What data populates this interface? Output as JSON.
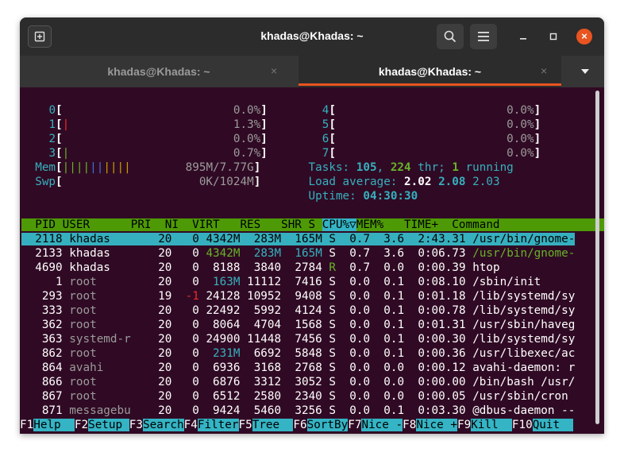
{
  "window": {
    "title": "khadas@Khadas: ~",
    "tabs": [
      {
        "label": "khadas@Khadas: ~",
        "active": false
      },
      {
        "label": "khadas@Khadas: ~",
        "active": true
      }
    ],
    "controls": {
      "close": "×",
      "tab_close": "×"
    }
  },
  "meters": {
    "cpus": [
      {
        "id": "0",
        "bar": "",
        "value": "0.0%"
      },
      {
        "id": "1",
        "bar": "|",
        "value": "1.3%"
      },
      {
        "id": "2",
        "bar": "",
        "value": "0.0%"
      },
      {
        "id": "3",
        "bar": "|",
        "value": "0.7%"
      },
      {
        "id": "4",
        "bar": "",
        "value": "0.0%"
      },
      {
        "id": "5",
        "bar": "",
        "value": "0.0%"
      },
      {
        "id": "6",
        "bar": "",
        "value": "0.0%"
      },
      {
        "id": "7",
        "bar": "",
        "value": "0.0%"
      }
    ],
    "mem": {
      "label": "Mem",
      "bar_green": "||||",
      "bar_blue": "||",
      "bar_yellow": "||||",
      "value": "895M/7.77G"
    },
    "swp": {
      "label": "Swp",
      "value": "0K/1024M"
    }
  },
  "stats": {
    "tasks_label": "Tasks: ",
    "tasks": "105",
    "thr": "224",
    "thr_label": " thr; ",
    "running": "1",
    "running_label": " running",
    "load_label": "Load average: ",
    "load1": "2.02",
    "load5": "2.08",
    "load15": "2.03",
    "uptime_label": "Uptime: ",
    "uptime": "04:30:30"
  },
  "columns": {
    "pre": "  PID USER      PRI  NI  VIRT   RES   SHR S ",
    "cpu": "CPU%▽",
    "post": "MEM%   TIME+  Command "
  },
  "processes": [
    {
      "pid": "2118",
      "user": "khadas",
      "pri": "20",
      "ni": "0",
      "virt": "4342M",
      "res": "283M",
      "shr": "165M",
      "s": "S",
      "cpu": "0.7",
      "mem": "3.6",
      "time": "2:43.31",
      "command": "/usr/bin/gnome-"
    },
    {
      "pid": "2133",
      "user": "khadas",
      "pri": "20",
      "ni": "0",
      "virt": "4342M",
      "res": "283M",
      "shr": "165M",
      "s": "S",
      "cpu": "0.7",
      "mem": "3.6",
      "time": "0:06.73",
      "command": "/usr/bin/gnome-"
    },
    {
      "pid": "4690",
      "user": "khadas",
      "pri": "20",
      "ni": "0",
      "virt": "8188",
      "res": "3840",
      "shr": "2784",
      "s": "R",
      "cpu": "0.7",
      "mem": "0.0",
      "time": "0:00.39",
      "command": "htop"
    },
    {
      "pid": "1",
      "user": "root",
      "pri": "20",
      "ni": "0",
      "virt": "163M",
      "res": "11112",
      "shr": "7416",
      "s": "S",
      "cpu": "0.0",
      "mem": "0.1",
      "time": "0:08.10",
      "command": "/sbin/init"
    },
    {
      "pid": "293",
      "user": "root",
      "pri": "19",
      "ni": "-1",
      "virt": "24128",
      "res": "10952",
      "shr": "9408",
      "s": "S",
      "cpu": "0.0",
      "mem": "0.1",
      "time": "0:01.18",
      "command": "/lib/systemd/sy"
    },
    {
      "pid": "333",
      "user": "root",
      "pri": "20",
      "ni": "0",
      "virt": "22492",
      "res": "5992",
      "shr": "4124",
      "s": "S",
      "cpu": "0.0",
      "mem": "0.1",
      "time": "0:00.78",
      "command": "/lib/systemd/sy"
    },
    {
      "pid": "362",
      "user": "root",
      "pri": "20",
      "ni": "0",
      "virt": "8064",
      "res": "4704",
      "shr": "1568",
      "s": "S",
      "cpu": "0.0",
      "mem": "0.1",
      "time": "0:01.31",
      "command": "/usr/sbin/haveg"
    },
    {
      "pid": "363",
      "user": "systemd-r",
      "pri": "20",
      "ni": "0",
      "virt": "24900",
      "res": "11448",
      "shr": "7456",
      "s": "S",
      "cpu": "0.0",
      "mem": "0.1",
      "time": "0:00.30",
      "command": "/lib/systemd/sy"
    },
    {
      "pid": "862",
      "user": "root",
      "pri": "20",
      "ni": "0",
      "virt": "231M",
      "res": "6692",
      "shr": "5848",
      "s": "S",
      "cpu": "0.0",
      "mem": "0.1",
      "time": "0:00.36",
      "command": "/usr/libexec/ac"
    },
    {
      "pid": "864",
      "user": "avahi",
      "pri": "20",
      "ni": "0",
      "virt": "6936",
      "res": "3168",
      "shr": "2768",
      "s": "S",
      "cpu": "0.0",
      "mem": "0.0",
      "time": "0:00.12",
      "command": "avahi-daemon: r"
    },
    {
      "pid": "866",
      "user": "root",
      "pri": "20",
      "ni": "0",
      "virt": "6876",
      "res": "3312",
      "shr": "3052",
      "s": "S",
      "cpu": "0.0",
      "mem": "0.0",
      "time": "0:00.00",
      "command": "/bin/bash /usr/"
    },
    {
      "pid": "867",
      "user": "root",
      "pri": "20",
      "ni": "0",
      "virt": "6512",
      "res": "2580",
      "shr": "2340",
      "s": "S",
      "cpu": "0.0",
      "mem": "0.0",
      "time": "0:00.05",
      "command": "/usr/sbin/cron"
    },
    {
      "pid": "871",
      "user": "messagebu",
      "pri": "20",
      "ni": "0",
      "virt": "9424",
      "res": "5460",
      "shr": "3256",
      "s": "S",
      "cpu": "0.0",
      "mem": "0.1",
      "time": "0:03.30",
      "command": "@dbus-daemon --"
    }
  ],
  "fkeys": [
    {
      "key": "F1",
      "label": "Help  "
    },
    {
      "key": "F2",
      "label": "Setup "
    },
    {
      "key": "F3",
      "label": "Search"
    },
    {
      "key": "F4",
      "label": "Filter"
    },
    {
      "key": "F5",
      "label": "Tree  "
    },
    {
      "key": "F6",
      "label": "SortBy"
    },
    {
      "key": "F7",
      "label": "Nice -"
    },
    {
      "key": "F8",
      "label": "Nice +"
    },
    {
      "key": "F9",
      "label": "Kill  "
    },
    {
      "key": "F10",
      "label": "Quit  "
    }
  ],
  "colors": {
    "accent": "#e95420",
    "terminal_bg": "#300a24",
    "header_bg": "#4e9a06",
    "highlight": "#36b0bf"
  }
}
